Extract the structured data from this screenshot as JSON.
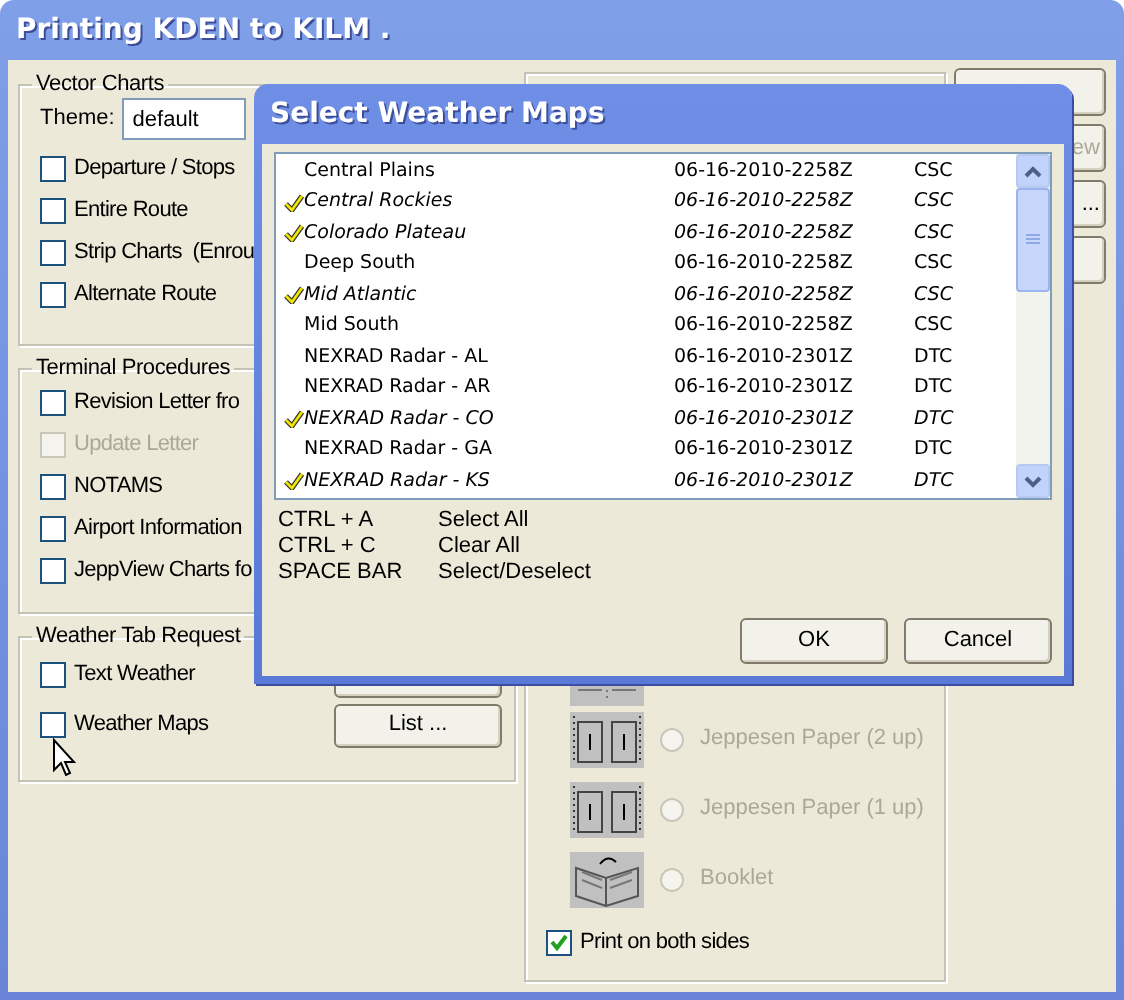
{
  "main_window": {
    "title": "Printing KDEN to KILM .",
    "vector_charts": {
      "legend": "Vector Charts",
      "theme_label": "Theme:",
      "theme_value": "default",
      "options": [
        {
          "label": "Departure / Stops",
          "checked": false,
          "disabled": false
        },
        {
          "label": "Entire Route",
          "checked": false,
          "disabled": false
        },
        {
          "label": "Strip Charts  (Enrou",
          "checked": false,
          "disabled": false
        },
        {
          "label": "Alternate Route",
          "checked": false,
          "disabled": false
        }
      ]
    },
    "terminal_procedures": {
      "legend": "Terminal Procedures",
      "options": [
        {
          "label": "Revision Letter fro",
          "checked": false,
          "disabled": false
        },
        {
          "label": "Update Letter",
          "checked": false,
          "disabled": true
        },
        {
          "label": "NOTAMS",
          "checked": false,
          "disabled": false
        },
        {
          "label": "Airport Information",
          "checked": false,
          "disabled": false
        },
        {
          "label": "JeppView Charts fo",
          "checked": false,
          "disabled": false
        }
      ]
    },
    "weather_tab_requests": {
      "legend": "Weather Tab Request",
      "options": [
        {
          "label": "Text Weather",
          "checked": false,
          "disabled": false
        },
        {
          "label": "Weather Maps",
          "checked": false,
          "disabled": false
        }
      ],
      "list_button": "List ..."
    },
    "layouts": [
      {
        "kind": "columns"
      },
      {
        "kind": "two-up",
        "label": "Jeppesen Paper (2 up)",
        "selected": false,
        "disabled": true
      },
      {
        "kind": "one-up",
        "label": "Jeppesen Paper (1 up)",
        "selected": false,
        "disabled": true
      },
      {
        "kind": "booklet",
        "label": "Booklet",
        "selected": false,
        "disabled": true
      }
    ],
    "print_both_sides": {
      "label": "Print on both sides",
      "checked": true
    },
    "side_buttons": [
      {
        "kind": "blank"
      },
      {
        "kind": "text",
        "label": "ew",
        "disabled": true
      },
      {
        "kind": "text",
        "label": "...",
        "disabled": false
      },
      {
        "kind": "blank"
      }
    ]
  },
  "dialog": {
    "title": "Select Weather Maps",
    "rows": [
      {
        "name": "Central Plains",
        "date": "06-16-2010-2258Z",
        "code": "CSC",
        "checked": false
      },
      {
        "name": "Central Rockies",
        "date": "06-16-2010-2258Z",
        "code": "CSC",
        "checked": true
      },
      {
        "name": "Colorado Plateau",
        "date": "06-16-2010-2258Z",
        "code": "CSC",
        "checked": true
      },
      {
        "name": "Deep South",
        "date": "06-16-2010-2258Z",
        "code": "CSC",
        "checked": false
      },
      {
        "name": "Mid Atlantic",
        "date": "06-16-2010-2258Z",
        "code": "CSC",
        "checked": true
      },
      {
        "name": "Mid South",
        "date": "06-16-2010-2258Z",
        "code": "CSC",
        "checked": false
      },
      {
        "name": "NEXRAD Radar - AL",
        "date": "06-16-2010-2301Z",
        "code": "DTC",
        "checked": false
      },
      {
        "name": "NEXRAD Radar - AR",
        "date": "06-16-2010-2301Z",
        "code": "DTC",
        "checked": false
      },
      {
        "name": "NEXRAD Radar - CO",
        "date": "06-16-2010-2301Z",
        "code": "DTC",
        "checked": true
      },
      {
        "name": "NEXRAD Radar - GA",
        "date": "06-16-2010-2301Z",
        "code": "DTC",
        "checked": false
      },
      {
        "name": "NEXRAD Radar - KS",
        "date": "06-16-2010-2301Z",
        "code": "DTC",
        "checked": true
      }
    ],
    "shortcuts": [
      {
        "keys": "CTRL + A",
        "action": "Select All"
      },
      {
        "keys": "CTRL + C",
        "action": "Clear All"
      },
      {
        "keys": "SPACE BAR",
        "action": "Select/Deselect"
      }
    ],
    "buttons": [
      "OK",
      "Cancel"
    ]
  }
}
